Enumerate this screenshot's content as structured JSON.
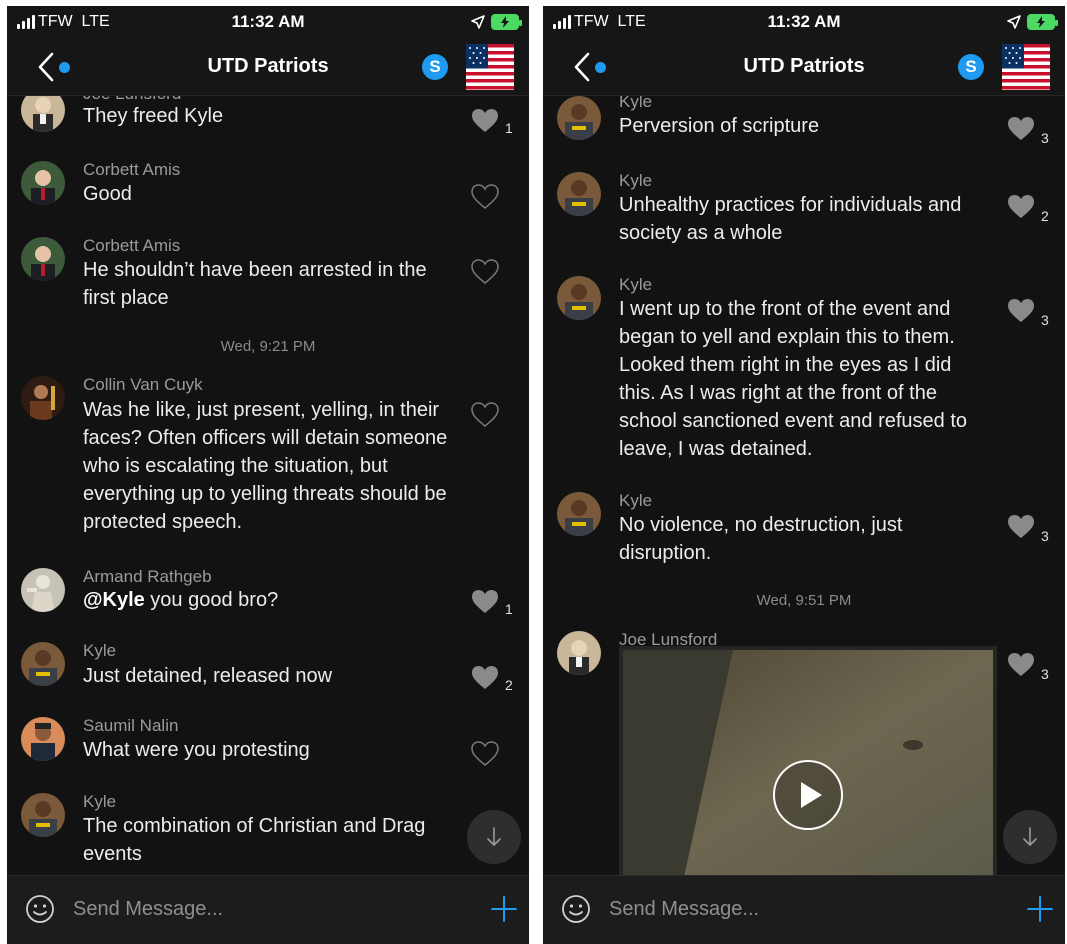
{
  "status_bar": {
    "carrier": "TFW",
    "network": "LTE",
    "time": "11:32 AM"
  },
  "nav": {
    "title": "UTD Patriots",
    "skype_label": "S"
  },
  "composer": {
    "placeholder": "Send Message..."
  },
  "left": {
    "messages": [
      {
        "sender": "Joe Lunsford",
        "text": "They freed Kyle",
        "likes": "1",
        "liked": true
      },
      {
        "sender": "Corbett Amis",
        "text": "Good",
        "likes": "",
        "liked": false
      },
      {
        "sender": "Corbett Amis",
        "text": "He shouldn’t have been arrested in the first place",
        "likes": "",
        "liked": false
      },
      {
        "sender": "Collin Van Cuyk",
        "text": "Was he like, just present, yelling, in their faces? Often officers will detain someone who is escalating the situation, but everything up to yelling threats should be protected speech.",
        "likes": "",
        "liked": false
      },
      {
        "sender": "Armand Rathgeb",
        "mention": "@Kyle",
        "text": " you good bro?",
        "likes": "1",
        "liked": true
      },
      {
        "sender": "Kyle",
        "text": "Just detained, released now",
        "likes": "2",
        "liked": true
      },
      {
        "sender": "Saumil Nalin",
        "text": "What were you protesting",
        "likes": "",
        "liked": false
      },
      {
        "sender": "Kyle",
        "text": "The combination of Christian and Drag events",
        "likes": "",
        "liked": false
      }
    ],
    "timestamp": "Wed, 9:21 PM"
  },
  "right": {
    "messages": [
      {
        "sender": "Kyle",
        "text": "Perversion of scripture",
        "likes": "3",
        "liked": true
      },
      {
        "sender": "Kyle",
        "text": "Unhealthy practices for individuals and society as a whole",
        "likes": "2",
        "liked": true
      },
      {
        "sender": "Kyle",
        "text": "I went up to the front of the event and began to yell and explain this to them. Looked them right in the eyes as I did this. As I was right at the front of the school sanctioned event and refused to leave, I was detained.",
        "likes": "3",
        "liked": true
      },
      {
        "sender": "Kyle",
        "text": "No violence, no destruction, just disruption.",
        "likes": "3",
        "liked": true
      },
      {
        "sender": "Joe Lunsford",
        "text": "",
        "likes": "3",
        "liked": true,
        "attachment": "video"
      }
    ],
    "timestamp": "Wed, 9:51 PM"
  },
  "colors": {
    "accent": "#1e9bf0",
    "background": "#121212",
    "battery": "#4cd964"
  },
  "icons": [
    "back-chevron-icon",
    "skype-icon",
    "us-flag-icon",
    "heart-icon",
    "heart-outline-icon",
    "play-icon",
    "arrow-down-icon",
    "emoji-icon",
    "plus-icon"
  ]
}
